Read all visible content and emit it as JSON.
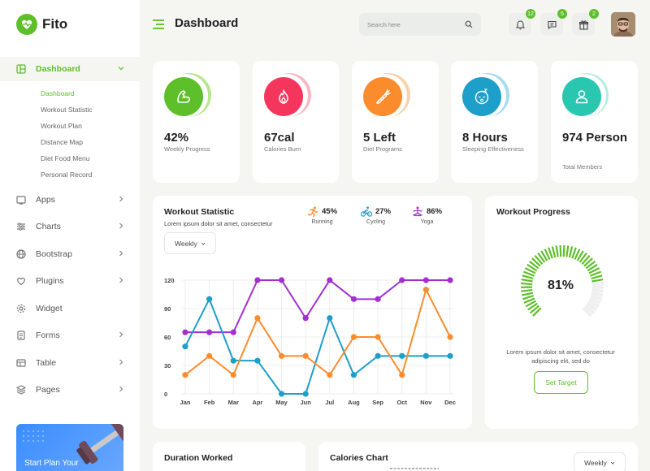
{
  "app": {
    "name": "Fito"
  },
  "sidebar": {
    "main_items": [
      {
        "label": "Dashboard",
        "icon": "dashboard-icon"
      },
      {
        "label": "Apps",
        "icon": "apps-icon"
      },
      {
        "label": "Charts",
        "icon": "charts-icon"
      },
      {
        "label": "Bootstrap",
        "icon": "bootstrap-icon"
      },
      {
        "label": "Plugins",
        "icon": "plugins-icon"
      },
      {
        "label": "Widget",
        "icon": "widget-icon"
      },
      {
        "label": "Forms",
        "icon": "forms-icon"
      },
      {
        "label": "Table",
        "icon": "table-icon"
      },
      {
        "label": "Pages",
        "icon": "pages-icon"
      }
    ],
    "sub_items": [
      "Dashboard",
      "Workout Statistic",
      "Workout Plan",
      "Distance Map",
      "Diet Food Menu",
      "Personal Record"
    ],
    "promo_text": "Start Plan Your"
  },
  "header": {
    "title": "Dashboard",
    "search_placeholder": "Search here",
    "notifications": {
      "count": "12"
    },
    "messages": {
      "count": "5"
    },
    "gifts": {
      "count": "2"
    }
  },
  "stats": [
    {
      "value": "42%",
      "label": "Weekly Progress",
      "color": "#5dbf2a",
      "icon": "muscle-icon"
    },
    {
      "value": "67cal",
      "label": "Calories Burn",
      "color": "#f5365c",
      "icon": "flame-icon"
    },
    {
      "value": "5 Left",
      "label": "Diet Programs",
      "color": "#fb8c2e",
      "icon": "carrot-icon"
    },
    {
      "value": "8 Hours",
      "label": "Sleeping Effectiveness",
      "color": "#1e9fc9",
      "icon": "sleep-face-icon"
    },
    {
      "value": "974 Person",
      "label": "Total Members",
      "color": "#2ac7b0",
      "icon": "person-icon"
    }
  ],
  "workout_statistic": {
    "title": "Workout Statistic",
    "subtitle": "Lorem ipsum dolor sit amet, consectetur",
    "dropdown": "Weekly",
    "legend": [
      {
        "value": "45%",
        "label": "Running",
        "color": "#fb8c2e",
        "icon": "running-icon"
      },
      {
        "value": "27%",
        "label": "Cycling",
        "color": "#1e9fc9",
        "icon": "cycling-icon"
      },
      {
        "value": "86%",
        "label": "Yoga",
        "color": "#a32fd1",
        "icon": "yoga-icon"
      }
    ]
  },
  "chart_data": {
    "type": "line",
    "categories": [
      "Jan",
      "Feb",
      "Mar",
      "Apr",
      "May",
      "Jun",
      "Jul",
      "Aug",
      "Sep",
      "Oct",
      "Nov",
      "Dec"
    ],
    "yticks": [
      0,
      30,
      60,
      90,
      120
    ],
    "ylim": [
      0,
      120
    ],
    "grid": true,
    "series": [
      {
        "color": "#a32fd1",
        "values": [
          65,
          65,
          65,
          120,
          120,
          80,
          120,
          100,
          100,
          120,
          120,
          120
        ]
      },
      {
        "color": "#1e9fc9",
        "values": [
          50,
          100,
          35,
          35,
          0,
          0,
          80,
          20,
          40,
          40,
          40,
          40
        ]
      },
      {
        "color": "#fb8c2e",
        "values": [
          20,
          40,
          20,
          80,
          40,
          40,
          20,
          60,
          60,
          20,
          110,
          60
        ]
      }
    ]
  },
  "workout_progress": {
    "title": "Workout Progress",
    "percent": "81%",
    "value": 81,
    "description": "Lorem ipsum dolor sit amet, consectetur adipiscing elit, sed do",
    "button": "Set Target"
  },
  "bottom": {
    "duration_title": "Duration Worked",
    "calories_title": "Calories Chart",
    "calories_dropdown": "Weekly"
  }
}
